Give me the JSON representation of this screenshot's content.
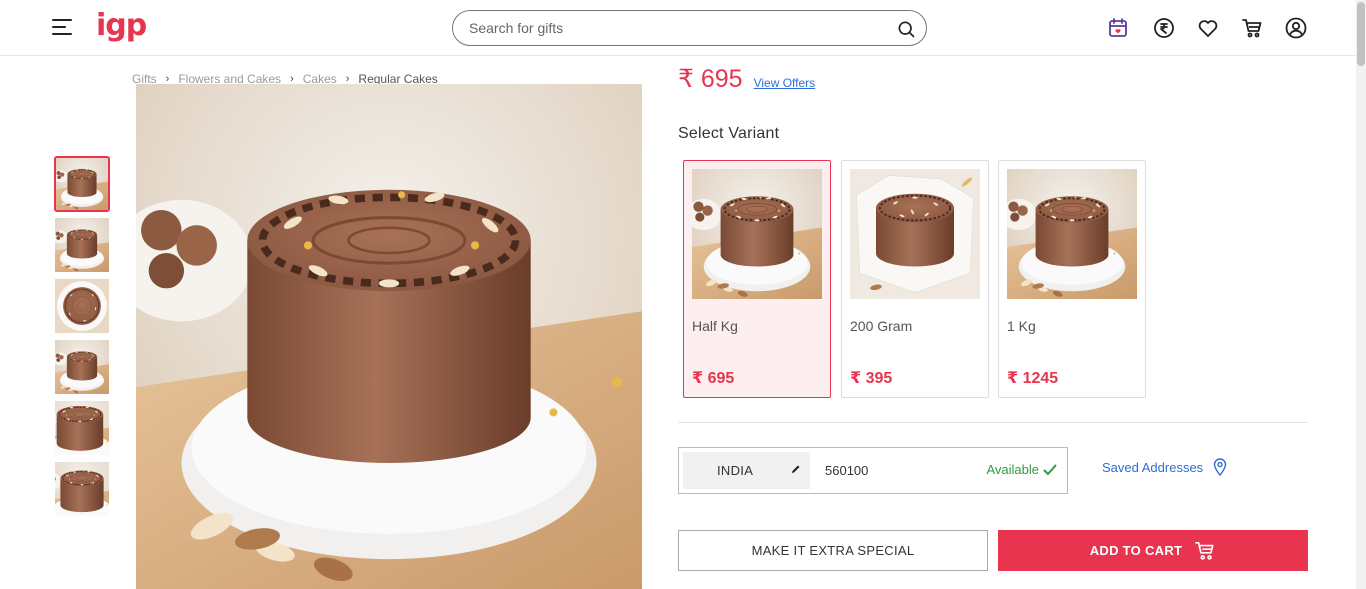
{
  "header": {
    "logo_text": "igp",
    "search_placeholder": "Search for gifts",
    "icons": [
      "menu-icon",
      "search-icon",
      "calendar-icon",
      "rupee-icon",
      "heart-icon",
      "cart-icon",
      "user-icon"
    ]
  },
  "breadcrumb": [
    "Gifts",
    "Flowers and Cakes",
    "Cakes",
    "Regular Cakes"
  ],
  "product": {
    "price": "₹ 695",
    "view_offers": "View Offers",
    "select_variant_label": "Select Variant"
  },
  "variants": [
    {
      "name": "Half Kg",
      "price": "₹ 695",
      "selected": true
    },
    {
      "name": "200 Gram",
      "price": "₹ 395",
      "selected": false
    },
    {
      "name": "1 Kg",
      "price": "₹ 1245",
      "selected": false
    }
  ],
  "delivery": {
    "country": "INDIA",
    "pincode": "560100",
    "status": "Available",
    "saved_addresses": "Saved Addresses"
  },
  "actions": {
    "extra_special": "MAKE IT EXTRA SPECIAL",
    "add_to_cart": "ADD TO CART"
  },
  "colors": {
    "brand": "#e8344e",
    "link": "#2e6fd6",
    "available": "#2e9a3e",
    "selected_bg": "#fdeef0"
  }
}
